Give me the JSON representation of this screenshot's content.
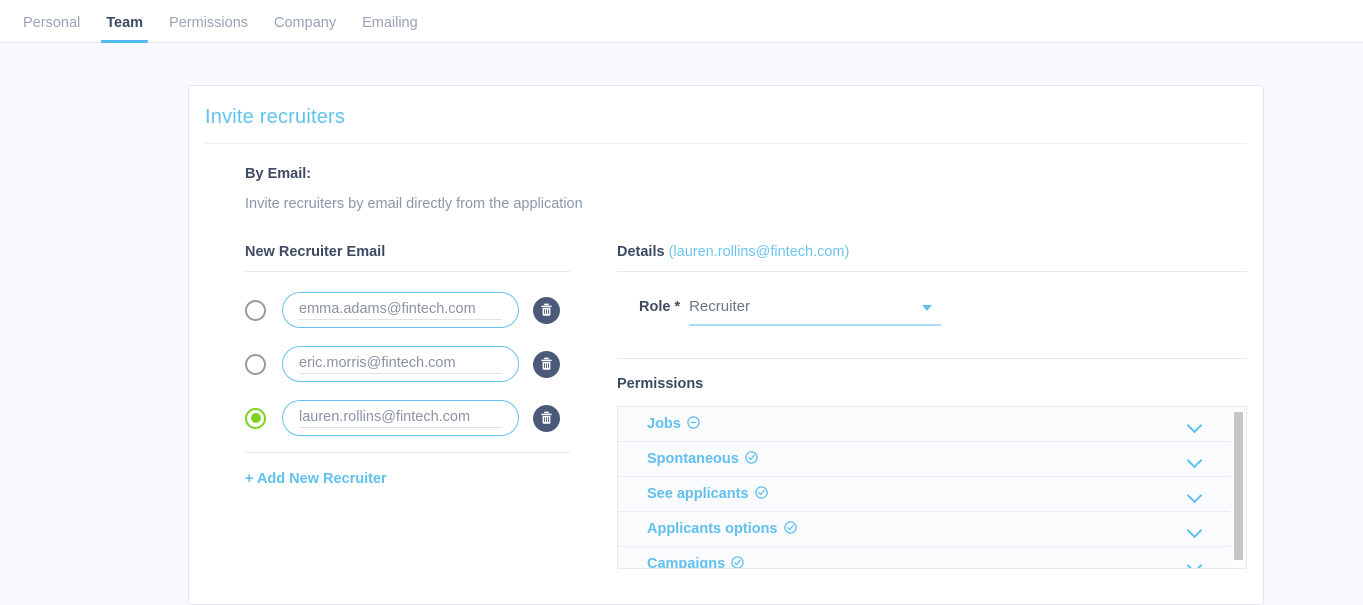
{
  "tabs": [
    {
      "label": "Personal",
      "active": false
    },
    {
      "label": "Team",
      "active": true
    },
    {
      "label": "Permissions",
      "active": false
    },
    {
      "label": "Company",
      "active": false
    },
    {
      "label": "Emailing",
      "active": false
    }
  ],
  "card": {
    "title": "Invite recruiters",
    "section_heading": "By Email:",
    "section_subtext": "Invite recruiters by email directly from the application"
  },
  "left_column": {
    "heading": "New Recruiter Email",
    "recruiters": [
      {
        "email": "emma.adams@fintech.com",
        "selected": false
      },
      {
        "email": "eric.morris@fintech.com",
        "selected": false
      },
      {
        "email": "lauren.rollins@fintech.com",
        "selected": true
      }
    ],
    "add_link": "+ Add New Recruiter",
    "delete_icon": "trash-icon",
    "radio_icon": "radio-button-icon"
  },
  "details": {
    "heading": "Details",
    "heading_email": "(lauren.rollins@fintech.com)",
    "role_label": "Role *",
    "role_value": "Recruiter",
    "role_caret_icon": "chevron-down-icon",
    "permissions_heading": "Permissions",
    "permissions": [
      {
        "label": "Jobs",
        "state_icon": "minus-circle-icon",
        "expand_icon": "chevron-down-icon"
      },
      {
        "label": "Spontaneous",
        "state_icon": "check-circle-icon",
        "expand_icon": "chevron-down-icon"
      },
      {
        "label": "See applicants",
        "state_icon": "check-circle-icon",
        "expand_icon": "chevron-down-icon"
      },
      {
        "label": "Applicants options",
        "state_icon": "check-circle-icon",
        "expand_icon": "chevron-down-icon"
      },
      {
        "label": "Campaigns",
        "state_icon": "check-circle-icon",
        "expand_icon": "chevron-down-icon"
      }
    ]
  },
  "colors": {
    "accent_blue": "#62c0ee",
    "title_blue": "#60c3ef",
    "dark_text": "#3d4a62",
    "muted_text": "#8d96a8",
    "selected_green": "#7ed321",
    "trash_circle": "#4a5a78",
    "page_bg": "#f8f9fc"
  }
}
